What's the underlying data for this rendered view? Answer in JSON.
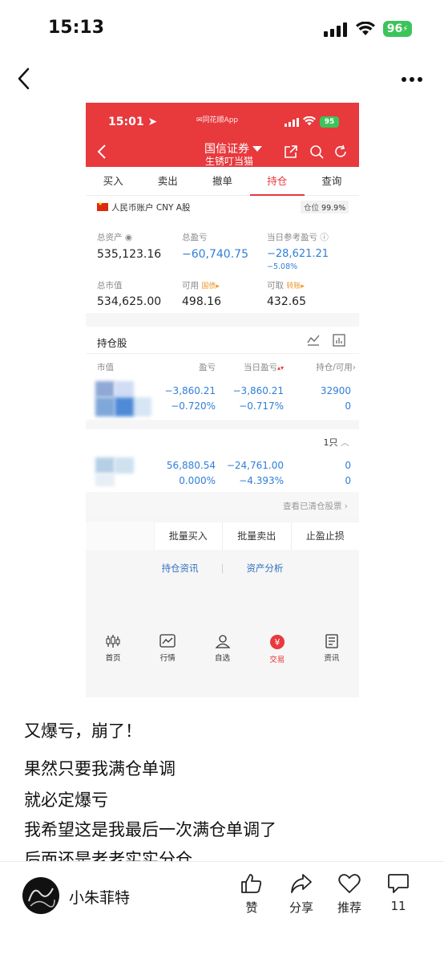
{
  "status_bar": {
    "time": "15:13",
    "battery": "96"
  },
  "inner": {
    "status_time": "15:01",
    "app_name": "同花顺App",
    "battery": "95",
    "broker": "国信证券",
    "nickname": "生锈叮当猫",
    "tabs": [
      "买入",
      "卖出",
      "撤单",
      "持仓",
      "查询"
    ],
    "active_tab": "持仓",
    "account_label": "人民币账户 CNY A股",
    "position_label": "仓位",
    "position_value": "99.9%",
    "summary": {
      "total_assets_label": "总资产",
      "total_assets": "535,123.16",
      "total_pl_label": "总盈亏",
      "total_pl": "−60,740.75",
      "daily_pl_label": "当日参考盈亏",
      "daily_pl": "−28,621.21",
      "daily_pl_pct": "−5.08%",
      "market_value_label": "总市值",
      "market_value": "534,625.00",
      "available_label": "可用",
      "available_tag": "国债▸",
      "available": "498.16",
      "withdrawable_label": "可取",
      "withdrawable_tag": "转账▸",
      "withdrawable": "432.65"
    },
    "holdings_title": "持仓股",
    "columns": [
      "市值",
      "盈亏",
      "当日盈亏",
      "持仓/可用"
    ],
    "row1": {
      "pl": "−3,860.21",
      "pl_pct": "−0.720%",
      "day_pl": "−3,860.21",
      "day_pl_pct": "−0.717%",
      "qty": "32900",
      "avail": "0"
    },
    "section2_count": "1只",
    "row2": {
      "pl": "56,880.54",
      "pl_pct": "0.000%",
      "day_pl": "−24,761.00",
      "day_pl_pct": "−4.393%",
      "qty": "0",
      "avail": "0"
    },
    "cleared_link": "查看已清仓股票",
    "batch": [
      "批量买入",
      "批量卖出",
      "止盈止损"
    ],
    "links": [
      "持仓资讯",
      "资产分析"
    ],
    "bottom_nav": [
      "首页",
      "行情",
      "自选",
      "交易",
      "资讯"
    ],
    "bottom_active": "交易"
  },
  "caption": {
    "line1": "又爆亏，崩了！",
    "line2": "果然只要我满仓单调",
    "line3": "就必定爆亏",
    "line4": "我希望这是我最后一次满仓单调了",
    "line5": "后面还是老老实实分仓"
  },
  "author": "小朱菲特",
  "actions": {
    "like": "赞",
    "share": "分享",
    "recommend": "推荐",
    "comment_count": "11"
  }
}
